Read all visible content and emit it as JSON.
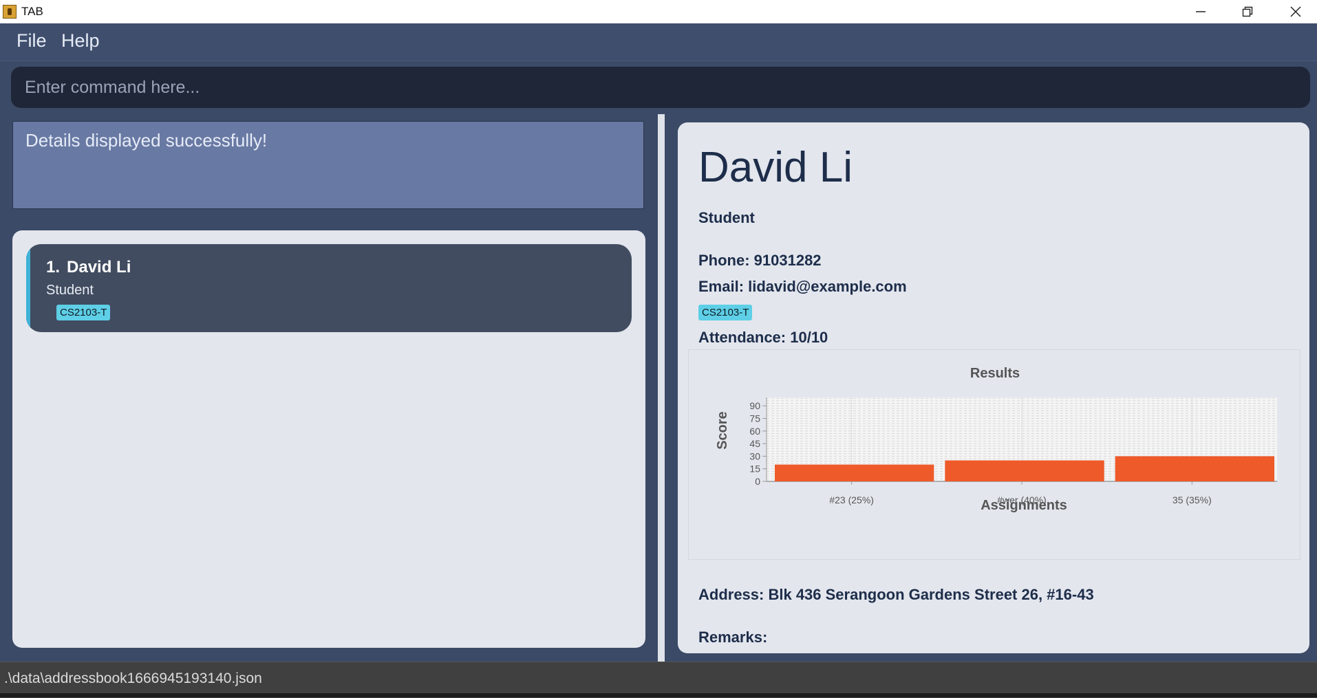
{
  "window": {
    "title": "TAB"
  },
  "menu": {
    "items": [
      "File",
      "Help"
    ]
  },
  "command": {
    "placeholder": "Enter command here..."
  },
  "result": {
    "message": "Details displayed successfully!"
  },
  "list": {
    "persons": [
      {
        "index": "1.",
        "name": "David Li",
        "role": "Student",
        "tags": [
          "CS2103-T"
        ]
      }
    ]
  },
  "detail": {
    "name": "David Li",
    "role": "Student",
    "phone": "Phone: 91031282",
    "email": "Email: lidavid@example.com",
    "tag": "CS2103-T",
    "attendance": "Attendance: 10/10",
    "address": "Address: Blk 436 Serangoon Gardens Street 26, #16-43",
    "remarks": "Remarks:"
  },
  "chart_data": {
    "type": "bar",
    "title": "Results",
    "xlabel": "Assignments",
    "ylabel": "Score",
    "categories": [
      "#23 (25%)",
      "#wer (40%)",
      "35 (35%)"
    ],
    "values": [
      20,
      25,
      30
    ],
    "yticks": [
      0,
      15,
      30,
      45,
      60,
      75,
      90
    ],
    "ylim": [
      0,
      100
    ],
    "bar_color": "#ee5a2a",
    "grid": true
  },
  "status": {
    "path": ".\\data\\addressbook1666945193140.json"
  },
  "colors": {
    "accent": "#3fb2d6",
    "tag_bg": "#5ecfe6",
    "result_bg": "#6879a3",
    "card_bg": "#414c60"
  }
}
